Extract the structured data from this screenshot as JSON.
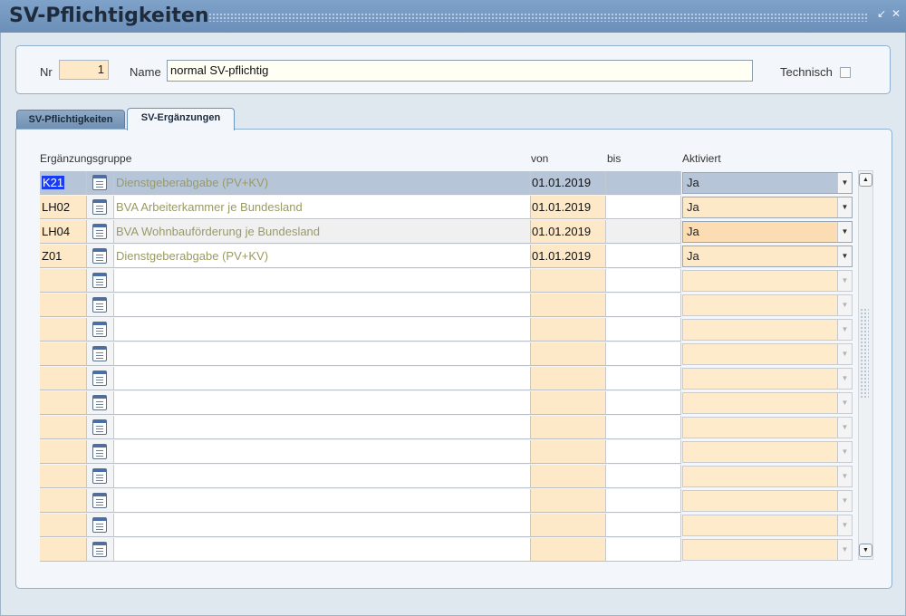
{
  "window": {
    "title": "SV-Pflichtigkeiten"
  },
  "header": {
    "nr_label": "Nr",
    "nr_value": "1",
    "name_label": "Name",
    "name_value": "normal SV-pflichtig",
    "technisch_label": "Technisch"
  },
  "tabs": [
    {
      "label": "SV-Pflichtigkeiten",
      "active": false
    },
    {
      "label": "SV-Ergänzungen",
      "active": true
    }
  ],
  "table": {
    "headers": {
      "group": "Ergänzungsgruppe",
      "von": "von",
      "bis": "bis",
      "aktiviert": "Aktiviert"
    },
    "rows": [
      {
        "code": "K21",
        "desc": "Dienstgeberabgabe (PV+KV)",
        "von": "01.01.2019",
        "bis": "",
        "aktiviert": "Ja"
      },
      {
        "code": "LH02",
        "desc": "BVA Arbeiterkammer je Bundesland",
        "von": "01.01.2019",
        "bis": "",
        "aktiviert": "Ja"
      },
      {
        "code": "LH04",
        "desc": "BVA Wohnbauförderung je Bundesland",
        "von": "01.01.2019",
        "bis": "",
        "aktiviert": "Ja"
      },
      {
        "code": "Z01",
        "desc": "Dienstgeberabgabe (PV+KV)",
        "von": "01.01.2019",
        "bis": "",
        "aktiviert": "Ja"
      }
    ],
    "empty_rows": 12
  },
  "icons": {
    "row_lookup": "list-document-icon",
    "dropdown": "chevron-down-icon",
    "minimize": "minimize-icon",
    "close": "close-icon",
    "scroll_up": "scroll-up-icon",
    "scroll_down": "scroll-down-icon"
  }
}
